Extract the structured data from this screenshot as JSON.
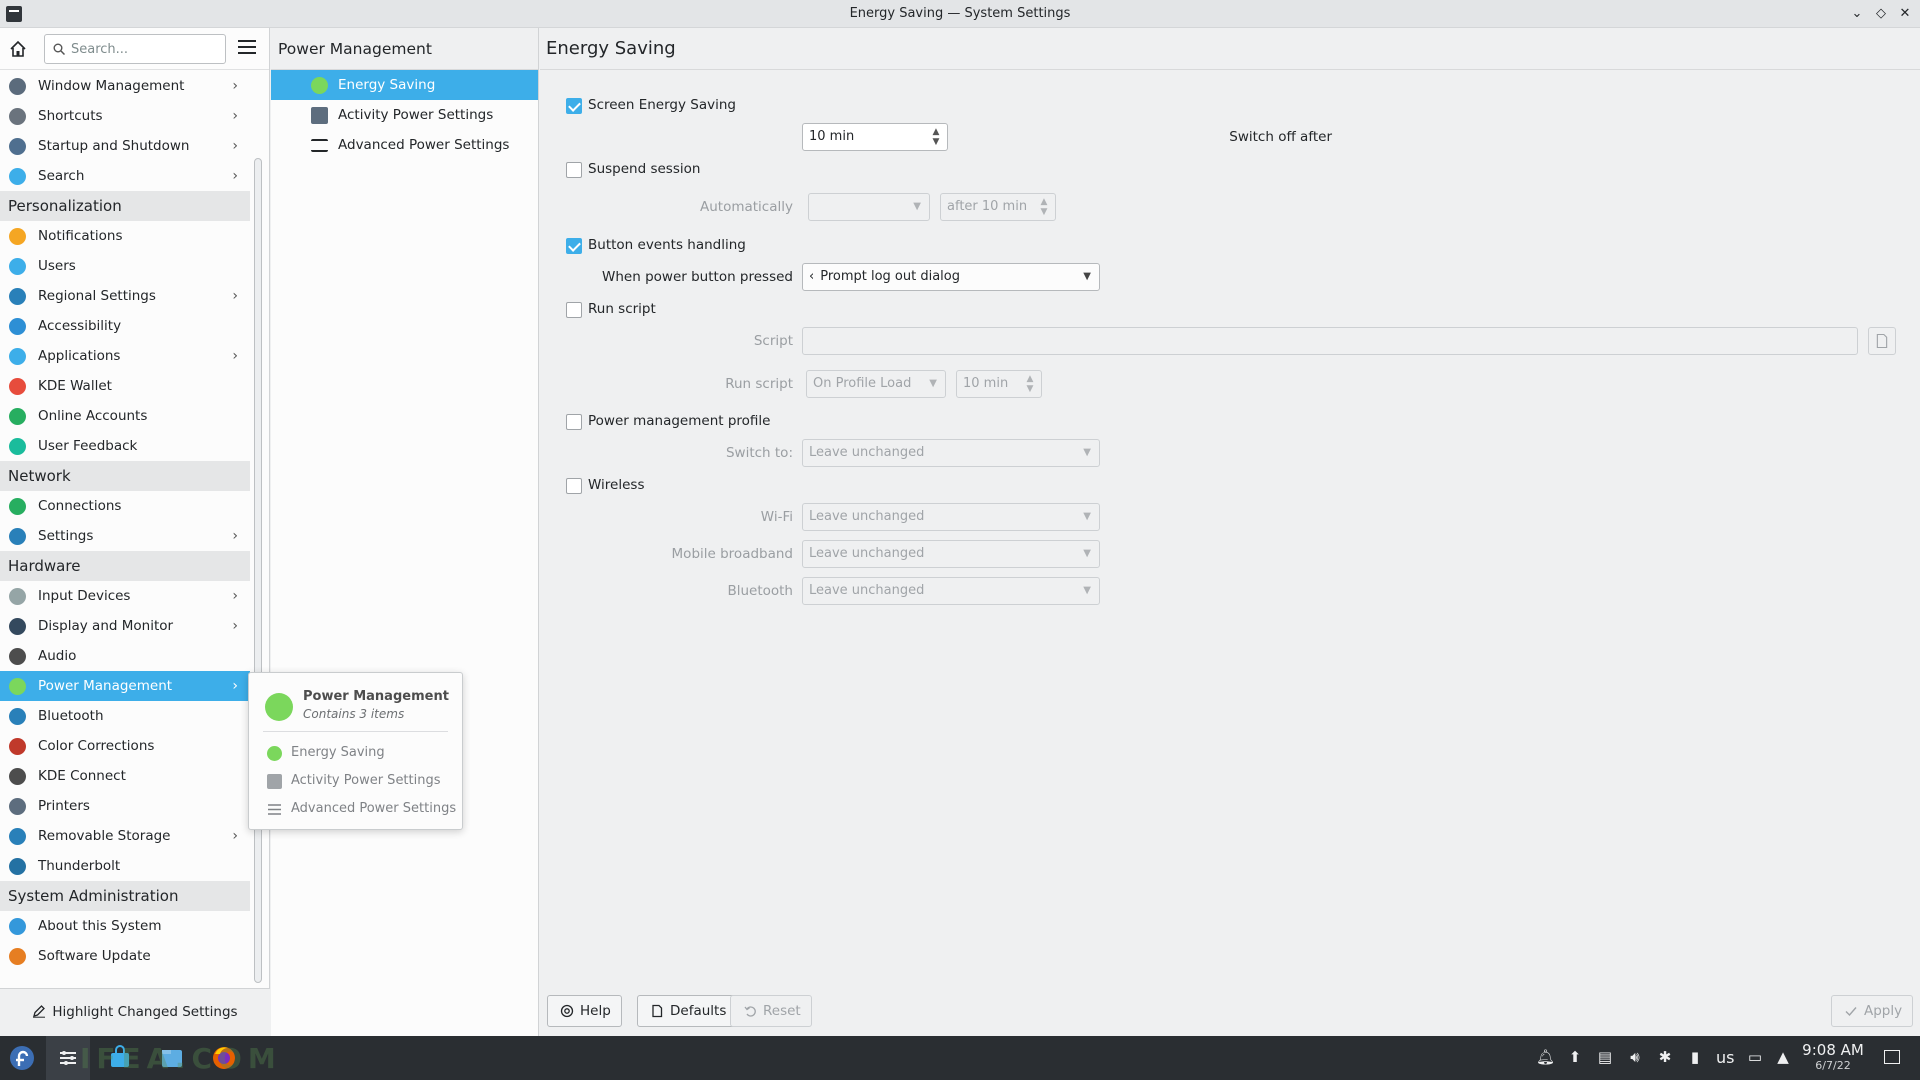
{
  "window": {
    "title": "Energy Saving — System Settings",
    "min_glyph": "⌄",
    "max_glyph": "◇",
    "close_glyph": "✕"
  },
  "sidebar": {
    "search_placeholder": "Search...",
    "items": [
      {
        "type": "item",
        "label": "Window Management",
        "icon": "window-icon",
        "color": "#5b6b7c",
        "chevron": true
      },
      {
        "type": "item",
        "label": "Shortcuts",
        "icon": "keyboard-icon",
        "color": "#6a737d",
        "chevron": true
      },
      {
        "type": "item",
        "label": "Startup and Shutdown",
        "icon": "startup-icon",
        "color": "#4f6f8f",
        "chevron": true
      },
      {
        "type": "item",
        "label": "Search",
        "icon": "search-icon",
        "color": "#3daee9",
        "chevron": true
      },
      {
        "type": "section",
        "label": "Personalization"
      },
      {
        "type": "item",
        "label": "Notifications",
        "icon": "bell-icon",
        "color": "#f5a623",
        "chevron": false
      },
      {
        "type": "item",
        "label": "Users",
        "icon": "users-icon",
        "color": "#3daee9",
        "chevron": false
      },
      {
        "type": "item",
        "label": "Regional Settings",
        "icon": "flag-icon",
        "color": "#2980b9",
        "chevron": true
      },
      {
        "type": "item",
        "label": "Accessibility",
        "icon": "accessibility-icon",
        "color": "#2d8fd5",
        "chevron": false
      },
      {
        "type": "item",
        "label": "Applications",
        "icon": "applications-icon",
        "color": "#3daee9",
        "chevron": true
      },
      {
        "type": "item",
        "label": "KDE Wallet",
        "icon": "wallet-icon",
        "color": "#e74c3c",
        "chevron": false
      },
      {
        "type": "item",
        "label": "Online Accounts",
        "icon": "globe-icon",
        "color": "#27ae60",
        "chevron": false
      },
      {
        "type": "item",
        "label": "User Feedback",
        "icon": "feedback-icon",
        "color": "#1abc9c",
        "chevron": false
      },
      {
        "type": "section",
        "label": "Network"
      },
      {
        "type": "item",
        "label": "Connections",
        "icon": "connections-icon",
        "color": "#27ae60",
        "chevron": false
      },
      {
        "type": "item",
        "label": "Settings",
        "icon": "network-settings-icon",
        "color": "#2980b9",
        "chevron": true
      },
      {
        "type": "section",
        "label": "Hardware"
      },
      {
        "type": "item",
        "label": "Input Devices",
        "icon": "mouse-icon",
        "color": "#95a5a6",
        "chevron": true
      },
      {
        "type": "item",
        "label": "Display and Monitor",
        "icon": "monitor-icon",
        "color": "#34495e",
        "chevron": true
      },
      {
        "type": "item",
        "label": "Audio",
        "icon": "speaker-icon",
        "color": "#4d4d4d",
        "chevron": false
      },
      {
        "type": "item",
        "label": "Power Management",
        "icon": "power-icon",
        "color": "#7bd75c",
        "chevron": true,
        "selected": true
      },
      {
        "type": "item",
        "label": "Bluetooth",
        "icon": "bluetooth-icon",
        "color": "#2980b9",
        "chevron": false
      },
      {
        "type": "item",
        "label": "Color Corrections",
        "icon": "color-icon",
        "color": "#c0392b",
        "chevron": false
      },
      {
        "type": "item",
        "label": "KDE Connect",
        "icon": "phone-icon",
        "color": "#4d4d4d",
        "chevron": false
      },
      {
        "type": "item",
        "label": "Printers",
        "icon": "printer-icon",
        "color": "#5d6d7e",
        "chevron": false
      },
      {
        "type": "item",
        "label": "Removable Storage",
        "icon": "usb-icon",
        "color": "#2980b9",
        "chevron": true
      },
      {
        "type": "item",
        "label": "Thunderbolt",
        "icon": "thunderbolt-icon",
        "color": "#2471a3",
        "chevron": false
      },
      {
        "type": "section",
        "label": "System Administration"
      },
      {
        "type": "item",
        "label": "About this System",
        "icon": "info-icon",
        "color": "#3498db",
        "chevron": false
      },
      {
        "type": "item",
        "label": "Software Update",
        "icon": "update-icon",
        "color": "#e67e22",
        "chevron": false
      }
    ],
    "highlight_label": "Highlight Changed Settings"
  },
  "subpanel": {
    "title": "Power Management",
    "items": [
      {
        "label": "Energy Saving",
        "icon": "energy-icon",
        "selected": true
      },
      {
        "label": "Activity Power Settings",
        "icon": "activity-icon",
        "selected": false
      },
      {
        "label": "Advanced Power Settings",
        "icon": "list-icon",
        "selected": false
      }
    ]
  },
  "main": {
    "title": "Energy Saving",
    "screen_energy": {
      "label": "Screen Energy Saving",
      "checked": true,
      "switch_label": "Switch off after",
      "switch_value": "10 min"
    },
    "suspend": {
      "label": "Suspend session",
      "checked": false,
      "auto_label": "Automatically",
      "auto_value": "",
      "after_value": "after 10 min"
    },
    "button_events": {
      "label": "Button events handling",
      "checked": true,
      "power_label": "When power button pressed",
      "power_value": "Prompt log out dialog"
    },
    "run_script": {
      "label": "Run script",
      "checked": false,
      "script_label": "Script",
      "script_value": "",
      "run_label": "Run script",
      "run_value": "On Profile Load",
      "delay_value": "10 min"
    },
    "profile": {
      "label": "Power management profile",
      "checked": false,
      "switch_to_label": "Switch to:",
      "switch_to_value": "Leave unchanged"
    },
    "wireless": {
      "label": "Wireless",
      "checked": false,
      "wifi_label": "Wi-Fi",
      "wifi_value": "Leave unchanged",
      "mobile_label": "Mobile broadband",
      "mobile_value": "Leave unchanged",
      "bt_label": "Bluetooth",
      "bt_value": "Leave unchanged"
    },
    "buttons": {
      "help": "Help",
      "defaults": "Defaults",
      "reset": "Reset",
      "apply": "Apply"
    }
  },
  "tooltip": {
    "title": "Power Management",
    "subtitle": "Contains 3 items",
    "items": [
      "Energy Saving",
      "Activity Power Settings",
      "Advanced Power Settings"
    ]
  },
  "taskbar": {
    "watermark": "IFEA.COM",
    "keyboard_layout": "us",
    "time": "9:08 AM",
    "date": "6/7/22"
  }
}
